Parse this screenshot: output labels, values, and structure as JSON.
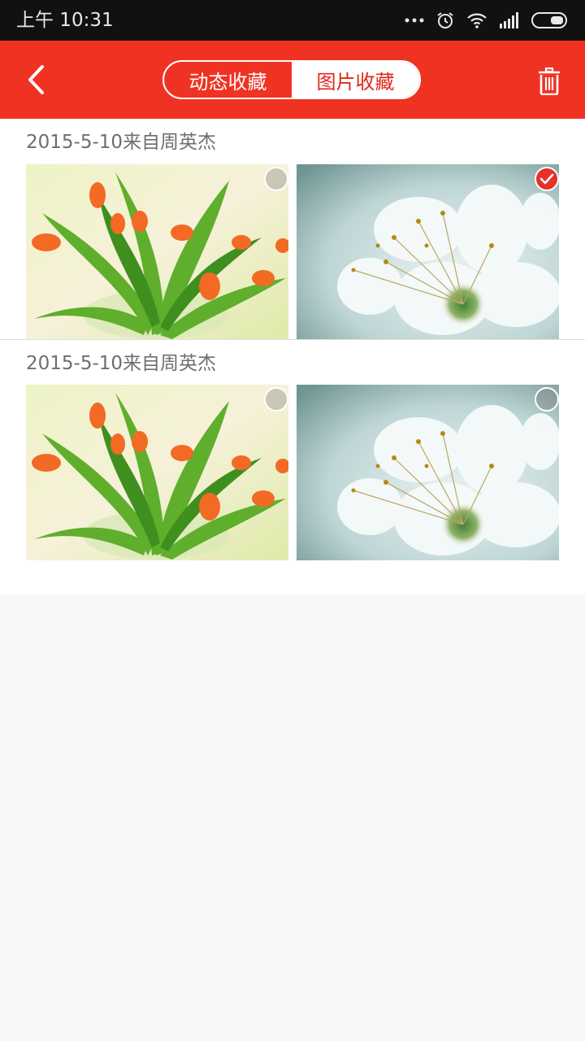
{
  "status_bar": {
    "time": "上午 10:31",
    "icons": [
      "more-dots-icon",
      "alarm-icon",
      "wifi-icon",
      "signal-icon",
      "battery-icon"
    ]
  },
  "header": {
    "back_icon": "chevron-left-icon",
    "tabs": [
      {
        "label": "动态收藏",
        "active": false
      },
      {
        "label": "图片收藏",
        "active": true
      }
    ],
    "trash_icon": "trash-icon"
  },
  "colors": {
    "accent": "#f03222",
    "status_bar": "#111111",
    "check_selected": "#e8302a"
  },
  "groups": [
    {
      "date_label": "2015-5-10来自周英杰",
      "photos": [
        {
          "subject": "tulips",
          "selected": false
        },
        {
          "subject": "white-blossom",
          "selected": true
        }
      ]
    },
    {
      "date_label": "2015-5-10来自周英杰",
      "photos": [
        {
          "subject": "tulips",
          "selected": false
        },
        {
          "subject": "white-blossom",
          "selected": false
        }
      ]
    }
  ]
}
